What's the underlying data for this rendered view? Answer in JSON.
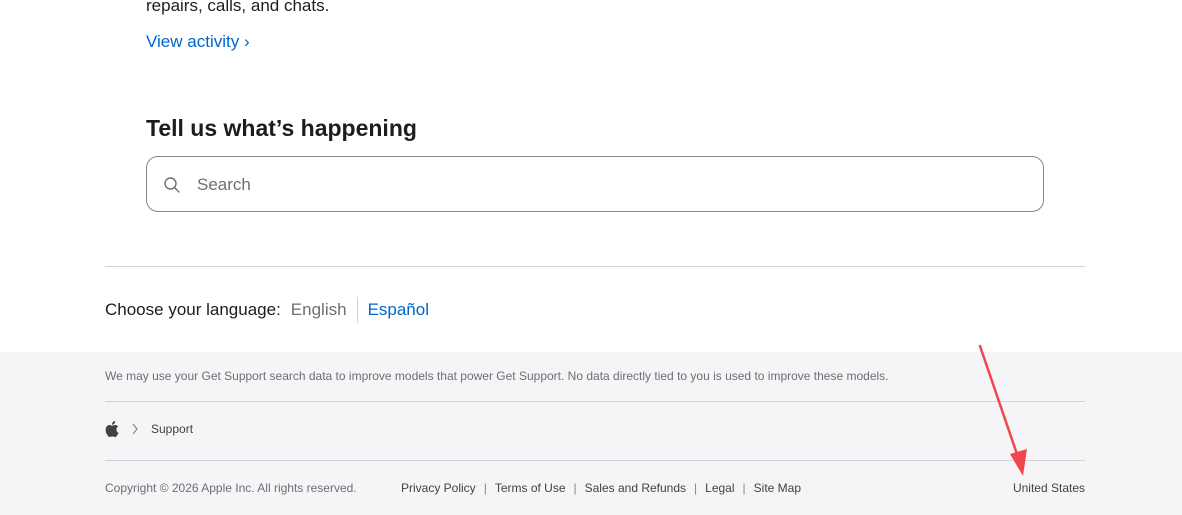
{
  "activity": {
    "summary_text": "repairs, calls, and chats.",
    "view_link": "View activity",
    "view_chevron": "›"
  },
  "search_section": {
    "title": "Tell us what’s happening",
    "placeholder": "Search",
    "icon": "search-icon"
  },
  "language": {
    "label": "Choose your language:",
    "current": "English",
    "alternate": "Español"
  },
  "footer": {
    "note": "We may use your Get Support search data to improve models that power Get Support. No data directly tied to you is used to improve these models.",
    "breadcrumb": {
      "logo_icon": "apple-logo-icon",
      "item": "Support"
    },
    "copyright": "Copyright © 2026 Apple Inc. All rights reserved.",
    "links": [
      "Privacy Policy",
      "Terms of Use",
      "Sales and Refunds",
      "Legal",
      "Site Map"
    ],
    "separator": "|",
    "country": "United States"
  },
  "annotation": {
    "color": "#f0474f"
  },
  "colors": {
    "link": "#0066cc",
    "text": "#1d1d1f",
    "footer_bg": "#f5f5f7"
  }
}
